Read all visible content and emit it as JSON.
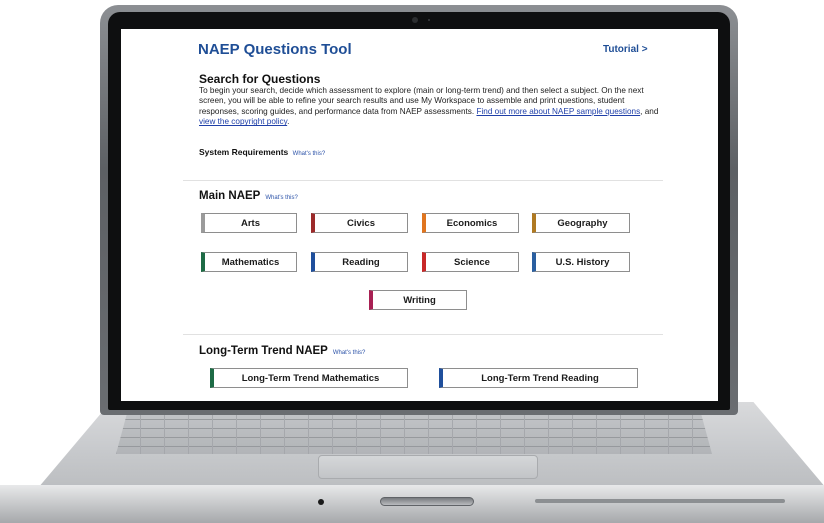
{
  "app": {
    "title": "NAEP Questions Tool",
    "tutorial_link": "Tutorial >"
  },
  "search": {
    "heading": "Search for Questions",
    "intro_text": "To begin your search, decide which assessment to explore (main or long-term trend) and then select a subject. On the next screen, you will be able to refine your search results and use My Workspace to assemble and print questions, student responses, scoring guides, and performance data from NAEP assessments.",
    "link_sample_questions": "Find out more about NAEP sample questions",
    "between_links": ", and ",
    "link_copyright": "view the copyright policy",
    "end_punct": ".",
    "system_requirements_label": "System Requirements",
    "whats_this": "What's this?"
  },
  "main_naep": {
    "heading": "Main NAEP",
    "whats_this": "What's this?",
    "subjects": [
      {
        "label": "Arts",
        "color": "#9b9b9b"
      },
      {
        "label": "Civics",
        "color": "#9c2a2a"
      },
      {
        "label": "Economics",
        "color": "#e0751f"
      },
      {
        "label": "Geography",
        "color": "#b07a22"
      },
      {
        "label": "Mathematics",
        "color": "#1d6b45"
      },
      {
        "label": "Reading",
        "color": "#1f4f9c"
      },
      {
        "label": "Science",
        "color": "#c82828"
      },
      {
        "label": "U.S. History",
        "color": "#2a5fa0"
      },
      {
        "label": "Writing",
        "color": "#a82053"
      }
    ]
  },
  "long_term_trend": {
    "heading": "Long-Term Trend NAEP",
    "whats_this": "What's this?",
    "subjects": [
      {
        "label": "Long-Term Trend Mathematics",
        "color": "#1d6b45"
      },
      {
        "label": "Long-Term Trend Reading",
        "color": "#1f4f9c"
      }
    ]
  }
}
